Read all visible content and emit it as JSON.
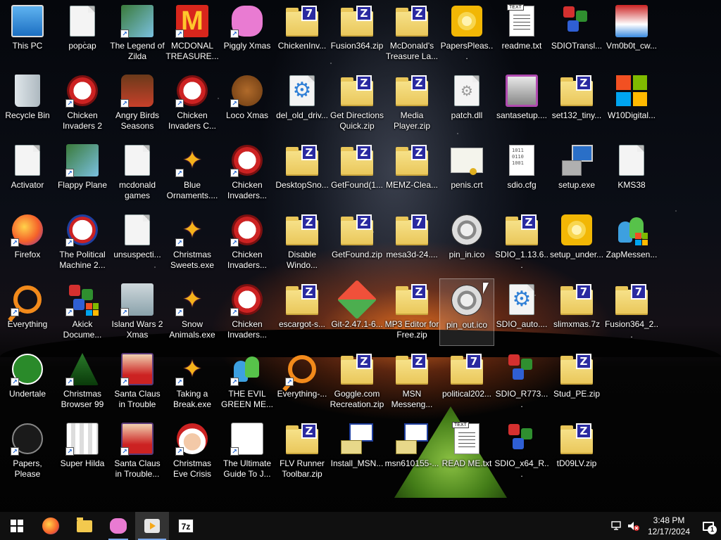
{
  "desktop": {
    "icons": [
      {
        "label": "This PC",
        "type": "pc"
      },
      {
        "label": "popcap",
        "type": "file"
      },
      {
        "label": "The Legend of Zilda",
        "type": "game"
      },
      {
        "label": "MCDONAL TREASURE...",
        "type": "mcd"
      },
      {
        "label": "Piggly Xmas",
        "type": "pig"
      },
      {
        "label": "ChickenInv...",
        "type": "zip7"
      },
      {
        "label": "Fusion364.zip",
        "type": "zip"
      },
      {
        "label": "McDonald's Treasure La...",
        "type": "zip"
      },
      {
        "label": "PapersPleas...",
        "type": "disc"
      },
      {
        "label": "readme.txt",
        "type": "text"
      },
      {
        "label": "SDIOTransl...",
        "type": "dice"
      },
      {
        "label": "Vm0b0t_cw...",
        "type": "santa"
      },
      {
        "label": "Recycle Bin",
        "type": "bin"
      },
      {
        "label": "Chicken Invaders 2",
        "type": "chicken"
      },
      {
        "label": "Angry Birds Seasons",
        "type": "angry"
      },
      {
        "label": "Chicken Invaders C...",
        "type": "chicken"
      },
      {
        "label": "Loco Xmas",
        "type": "bear"
      },
      {
        "label": "del_old_driv...",
        "type": "gear"
      },
      {
        "label": "Get Directions Quick.zip",
        "type": "zip"
      },
      {
        "label": "Media Player.zip",
        "type": "zip"
      },
      {
        "label": "patch.dll",
        "type": "dll"
      },
      {
        "label": "santasetup....",
        "type": "santasetup"
      },
      {
        "label": "set132_tiny...",
        "type": "zip"
      },
      {
        "label": "W10Digital...",
        "type": "windows"
      },
      {
        "label": "Activator",
        "type": "file"
      },
      {
        "label": "Flappy Plane",
        "type": "game"
      },
      {
        "label": "mcdonald games",
        "type": "file"
      },
      {
        "label": "Blue Ornaments....",
        "type": "stars"
      },
      {
        "label": "Chicken Invaders...",
        "type": "chicken"
      },
      {
        "label": "DesktopSno...",
        "type": "zip"
      },
      {
        "label": "GetFound(1...",
        "type": "zip"
      },
      {
        "label": "MEMZ-Clea...",
        "type": "zip"
      },
      {
        "label": "penis.crt",
        "type": "cert"
      },
      {
        "label": "sdio.cfg",
        "type": "cfg"
      },
      {
        "label": "setup.exe",
        "type": "setup"
      },
      {
        "label": "KMS38",
        "type": "file"
      },
      {
        "label": "Firefox",
        "type": "firefox"
      },
      {
        "label": "The Political Machine 2...",
        "type": "political"
      },
      {
        "label": "unsuspecti...",
        "type": "file"
      },
      {
        "label": "Christmas Sweets.exe",
        "type": "stars"
      },
      {
        "label": "Chicken Invaders...",
        "type": "chicken"
      },
      {
        "label": "Disable Windo...",
        "type": "zip"
      },
      {
        "label": "GetFound.zip",
        "type": "zip"
      },
      {
        "label": "mesa3d-24....",
        "type": "zip7"
      },
      {
        "label": "pin_in.ico",
        "type": "ico"
      },
      {
        "label": "SDIO_1.13.6...",
        "type": "zip"
      },
      {
        "label": "setup_under...",
        "type": "disc"
      },
      {
        "label": "ZapMessen...",
        "type": "msnwin"
      },
      {
        "label": "Everything",
        "type": "magnify"
      },
      {
        "label": "Akick Docume...",
        "type": "dicewin"
      },
      {
        "label": "Island Wars 2 Xmas",
        "type": "island"
      },
      {
        "label": "Snow Animals.exe",
        "type": "stars"
      },
      {
        "label": "Chicken Invaders...",
        "type": "chicken"
      },
      {
        "label": "escargot-s...",
        "type": "zip"
      },
      {
        "label": "Git-2.47.1-6...",
        "type": "git"
      },
      {
        "label": "MP3 Editor for Free.zip",
        "type": "zip"
      },
      {
        "label": "pin_out.ico",
        "type": "ico",
        "selected": true
      },
      {
        "label": "SDIO_auto....",
        "type": "gear"
      },
      {
        "label": "slimxmas.7z",
        "type": "zip7"
      },
      {
        "label": "Fusion364_2...",
        "type": "zip7"
      },
      {
        "label": "Undertale",
        "type": "undertale"
      },
      {
        "label": "Christmas Browser 99",
        "type": "tree"
      },
      {
        "label": "Santa Claus in Trouble",
        "type": "santagame"
      },
      {
        "label": "Taking a Break.exe",
        "type": "stars"
      },
      {
        "label": "THE EVIL GREEN ME...",
        "type": "msn"
      },
      {
        "label": "Everything-...",
        "type": "magnify"
      },
      {
        "label": "Goggle.com Recreation.zip",
        "type": "zip"
      },
      {
        "label": "MSN Messeng...",
        "type": "zip"
      },
      {
        "label": "political202...",
        "type": "zip7"
      },
      {
        "label": "SDIO_R773....",
        "type": "dice"
      },
      {
        "label": "Stud_PE.zip",
        "type": "zip"
      },
      {
        "label": "Papers, Please",
        "type": "papers"
      },
      {
        "label": "Super Hilda",
        "type": "hilda"
      },
      {
        "label": "Santa Claus in Trouble... A...",
        "type": "santagame"
      },
      {
        "label": "Christmas Eve Crisis",
        "type": "santaface"
      },
      {
        "label": "The Ultimate Guide To J...",
        "type": "guide"
      },
      {
        "label": "FLV Runner Toolbar.zip",
        "type": "zip"
      },
      {
        "label": "Install_MSN...",
        "type": "installer"
      },
      {
        "label": "msn610155-...",
        "type": "installer"
      },
      {
        "label": "READ ME.txt",
        "type": "text"
      },
      {
        "label": "SDIO_x64_R...",
        "type": "dice"
      },
      {
        "label": "tD09LV.zip",
        "type": "zip"
      }
    ]
  },
  "taskbar": {
    "pinned": [
      {
        "name": "start-button",
        "icon": "windows-icon"
      },
      {
        "name": "firefox-taskbar-button",
        "icon": "firefox-icon"
      },
      {
        "name": "file-explorer-taskbar-button",
        "icon": "folder-icon"
      },
      {
        "name": "piggly-taskbar-button",
        "icon": "pig-icon"
      },
      {
        "name": "media-player-taskbar-button",
        "icon": "media-icon",
        "active": true
      },
      {
        "name": "7zip-taskbar-button",
        "icon": "7zip-icon",
        "label": "7z"
      }
    ],
    "tray": {
      "time": "3:48 PM",
      "date": "12/17/2024",
      "notification_count": "1"
    }
  },
  "colors": {
    "taskbar_bg": "#101010",
    "zip_badge": "#2a2aa0",
    "folder": "#e9c659"
  }
}
